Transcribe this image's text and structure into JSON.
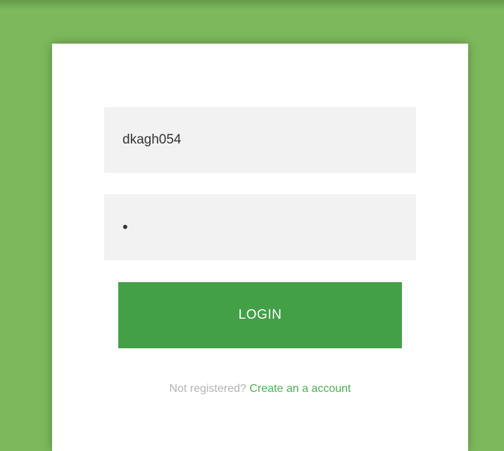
{
  "login_form": {
    "username_value": "dkagh054",
    "password_value": "•",
    "login_button_label": "LOGIN",
    "register_prompt": "Not registered?",
    "register_link_label": "Create an a account"
  },
  "colors": {
    "background": "#7cb95c",
    "card": "#ffffff",
    "field": "#f2f2f2",
    "button": "#43a047",
    "link": "#4caf50",
    "muted_text": "#b3b3b3"
  }
}
